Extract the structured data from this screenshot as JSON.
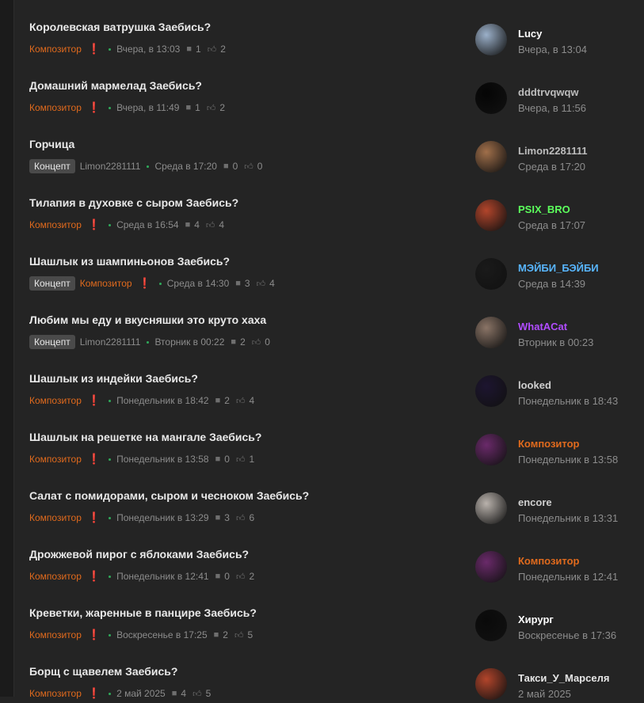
{
  "colors": {
    "background": "#242424",
    "composer_orange": "#e06a1d",
    "online_dot": "#2faa5a"
  },
  "threads": [
    {
      "title": "Королевская ватрушка Заебись?",
      "tags": [],
      "author": "Композитор",
      "author_highlight": true,
      "time": "Вчера, в 13:03",
      "replies": "1",
      "likes": "2",
      "last_user": "Lucy",
      "last_user_color": "#ffffff",
      "last_time": "Вчера, в 13:04",
      "avatar_color": "#9bb0c9"
    },
    {
      "title": "Домашний мармелад Заебись?",
      "tags": [],
      "author": "Композитор",
      "author_highlight": true,
      "time": "Вчера, в 11:49",
      "replies": "1",
      "likes": "2",
      "last_user": "dddtrvqwqw",
      "last_user_color": "#bdbdbd",
      "last_time": "Вчера, в 11:56",
      "avatar_color": "#050505"
    },
    {
      "title": "Горчица",
      "tags": [
        "Концепт"
      ],
      "author": "Limon2281111",
      "author_highlight": false,
      "time": "Среда в 17:20",
      "replies": "0",
      "likes": "0",
      "last_user": "Limon2281111",
      "last_user_color": "#bdbdbd",
      "last_time": "Среда в 17:20",
      "avatar_color": "#a06f4a"
    },
    {
      "title": "Тилапия в духовке с сыром Заебись?",
      "tags": [],
      "author": "Композитор",
      "author_highlight": true,
      "time": "Среда в 16:54",
      "replies": "4",
      "likes": "4",
      "last_user": "PSIX_BRO",
      "last_user_color": "#5cff5c",
      "last_time": "Среда в 17:07",
      "avatar_color": "#b2452b"
    },
    {
      "title": "Шашлык из шампиньонов Заебись?",
      "tags": [
        "Концепт"
      ],
      "author": "Композитор",
      "author_highlight": true,
      "time": "Среда в 14:30",
      "replies": "3",
      "likes": "4",
      "last_user": "МЭЙБИ_БЭЙБИ",
      "last_user_color": "#58b6ff",
      "last_time": "Среда в 14:39",
      "avatar_color": "#1a1a1a"
    },
    {
      "title": "Любим мы еду и вкусняшки это круто хаха",
      "tags": [
        "Концепт"
      ],
      "author": "Limon2281111",
      "author_highlight": false,
      "time": "Вторник в 00:22",
      "replies": "2",
      "likes": "0",
      "last_user": "WhatACat",
      "last_user_color": "#b14cff",
      "last_time": "Вторник в 00:23",
      "avatar_color": "#8a7466"
    },
    {
      "title": "Шашлык из индейки Заебись?",
      "tags": [],
      "author": "Композитор",
      "author_highlight": true,
      "time": "Понедельник в 18:42",
      "replies": "2",
      "likes": "4",
      "last_user": "looked",
      "last_user_color": "#cfcfcf",
      "last_time": "Понедельник в 18:43",
      "avatar_color": "#1d1530"
    },
    {
      "title": "Шашлык на решетке на мангале Заебись?",
      "tags": [],
      "author": "Композитор",
      "author_highlight": true,
      "time": "Понедельник в 13:58",
      "replies": "0",
      "likes": "1",
      "last_user": "Композитор",
      "last_user_color": "#e06a1d",
      "last_time": "Понедельник в 13:58",
      "avatar_color": "#6a2a6a"
    },
    {
      "title": "Салат с помидорами, сыром и чесноком Заебись?",
      "tags": [],
      "author": "Композитор",
      "author_highlight": true,
      "time": "Понедельник в 13:29",
      "replies": "3",
      "likes": "6",
      "last_user": "encore",
      "last_user_color": "#cfcfcf",
      "last_time": "Понедельник в 13:31",
      "avatar_color": "#b9b2ac"
    },
    {
      "title": "Дрожжевой пирог с яблоками Заебись?",
      "tags": [],
      "author": "Композитор",
      "author_highlight": true,
      "time": "Понедельник в 12:41",
      "replies": "0",
      "likes": "2",
      "last_user": "Композитор",
      "last_user_color": "#e06a1d",
      "last_time": "Понедельник в 12:41",
      "avatar_color": "#6a2a6a"
    },
    {
      "title": "Креветки, жаренные в панцире Заебись?",
      "tags": [],
      "author": "Композитор",
      "author_highlight": true,
      "time": "Воскресенье в 17:25",
      "replies": "2",
      "likes": "5",
      "last_user": "Хирург",
      "last_user_color": "#ffffff",
      "last_time": "Воскресенье в 17:36",
      "avatar_color": "#0a0a0a"
    },
    {
      "title": "Борщ с щавелем Заебись?",
      "tags": [],
      "author": "Композитор",
      "author_highlight": true,
      "time": "2 май 2025",
      "replies": "4",
      "likes": "5",
      "last_user": "Такси_У_Марселя",
      "last_user_color": "#e6e6e6",
      "last_time": "2 май 2025",
      "avatar_color": "#b2452b"
    }
  ]
}
